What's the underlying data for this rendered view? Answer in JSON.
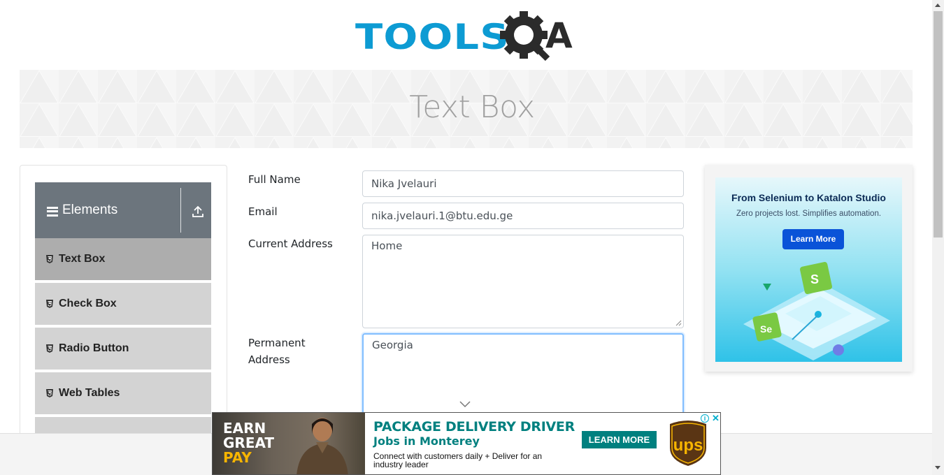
{
  "header": {
    "logo_text_left": "TOOLS",
    "logo_text_right": "A"
  },
  "banner": {
    "title": "Text Box"
  },
  "sidebar": {
    "group_title": "Elements",
    "items": [
      {
        "label": "Text Box",
        "active": true
      },
      {
        "label": "Check Box",
        "active": false
      },
      {
        "label": "Radio Button",
        "active": false
      },
      {
        "label": "Web Tables",
        "active": false
      }
    ]
  },
  "form": {
    "full_name": {
      "label": "Full Name",
      "value": "Nika Jvelauri"
    },
    "email": {
      "label": "Email",
      "value": "nika.jvelauri.1@btu.edu.ge"
    },
    "current_address": {
      "label": "Current Address",
      "value": "Home"
    },
    "permanent_address": {
      "label": "Permanent Address",
      "label_line1": "Permanent",
      "label_line2": "Address",
      "value": "Georgia"
    }
  },
  "side_ad": {
    "title": "From Selenium to Katalon Studio",
    "subtitle": "Zero projects lost. Simplifies automation.",
    "button_label": "Learn More"
  },
  "bottom_ad": {
    "earn_line1": "EARN",
    "earn_line2": "GREAT",
    "earn_line3": "PAY",
    "headline": "PACKAGE DELIVERY DRIVER",
    "subhead": "Jobs in Monterey",
    "body": "Connect with customers daily + Deliver for an industry leader",
    "cta": "LEARN MORE",
    "brand": "ups",
    "info_glyph": "i",
    "close_glyph": "✕"
  },
  "colors": {
    "brand_blue": "#0d9bd3",
    "sidebar_header": "#6c757d",
    "menu_item": "#d3d3d3",
    "menu_item_active": "#adadad",
    "focus_border": "#80bdff",
    "ad_teal": "#00807f"
  }
}
